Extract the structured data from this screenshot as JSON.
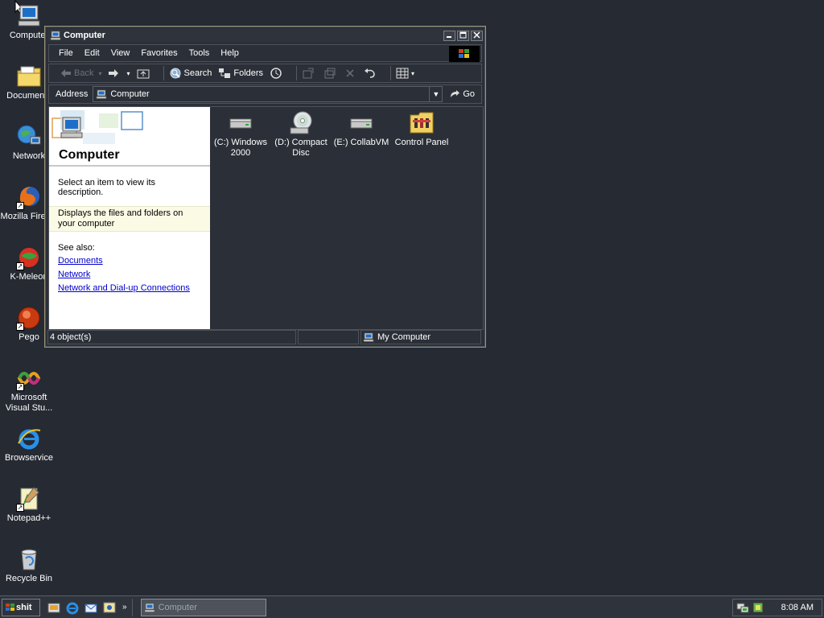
{
  "desktop": {
    "icons": [
      {
        "label": "Computer",
        "icon": "computer-icon"
      },
      {
        "label": "Documents",
        "icon": "documents-folder-icon"
      },
      {
        "label": "Network",
        "icon": "network-icon"
      },
      {
        "label": "Mozilla Firefox",
        "icon": "firefox-icon"
      },
      {
        "label": "K-Meleon",
        "icon": "kmeleon-icon"
      },
      {
        "label": "Pego",
        "icon": "pego-icon"
      },
      {
        "label_line1": "Microsoft",
        "label_line2": "Visual Stu...",
        "icon": "visual-studio-icon"
      },
      {
        "label": "Browservice",
        "icon": "internet-explorer-icon"
      },
      {
        "label": "Notepad++",
        "icon": "notepadpp-icon"
      },
      {
        "label": "Recycle Bin",
        "icon": "recycle-bin-icon"
      }
    ]
  },
  "window": {
    "title": "Computer",
    "menu": [
      "File",
      "Edit",
      "View",
      "Favorites",
      "Tools",
      "Help"
    ],
    "toolbar": {
      "back": "Back",
      "search": "Search",
      "folders": "Folders"
    },
    "address": {
      "label": "Address",
      "value": "Computer",
      "go": "Go"
    },
    "leftpane": {
      "title": "Computer",
      "instruction": "Select an item to view its description.",
      "description": "Displays the files and folders on your computer",
      "see_also": "See also:",
      "links": [
        "Documents",
        "Network",
        "Network and Dial-up Connections"
      ]
    },
    "items": [
      {
        "label_line1": "(C:) Windows",
        "label_line2": "2000",
        "icon": "hard-drive-icon"
      },
      {
        "label_line1": "(D:) Compact",
        "label_line2": "Disc",
        "icon": "cd-drive-icon"
      },
      {
        "label_line1": "(E:) CollabVM",
        "label_line2": "",
        "icon": "network-drive-icon"
      },
      {
        "label_line1": "Control Panel",
        "label_line2": "",
        "icon": "control-panel-icon"
      }
    ],
    "status": {
      "count": "4 object(s)",
      "zone": "My Computer"
    }
  },
  "taskbar": {
    "start_label": "shit",
    "task_label": "Computer",
    "more": "»",
    "clock": "8:08 AM"
  }
}
